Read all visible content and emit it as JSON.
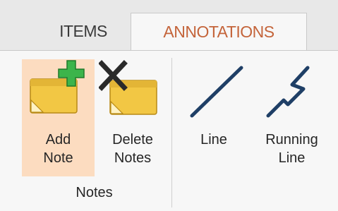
{
  "tabs": [
    {
      "label": "ITEMS",
      "active": false
    },
    {
      "label": "ANNOTATIONS",
      "active": true
    }
  ],
  "ribbon": {
    "add_note": {
      "line1": "Add",
      "line2": "Note",
      "icon": "add-note-icon"
    },
    "delete_notes": {
      "line1": "Delete",
      "line2": "Notes",
      "icon": "delete-notes-icon"
    },
    "line": {
      "line1": "Line",
      "icon": "line-icon"
    },
    "running_line": {
      "line1": "Running",
      "line2": "Line",
      "icon": "running-line-icon"
    },
    "group_label": "Notes"
  },
  "colors": {
    "active_tab_text": "#c4643a",
    "hover_highlight": "#fcdcc0",
    "icon_blue": "#1f3f66",
    "note_yellow": "#f2c744",
    "plus_green": "#3cb44b"
  }
}
